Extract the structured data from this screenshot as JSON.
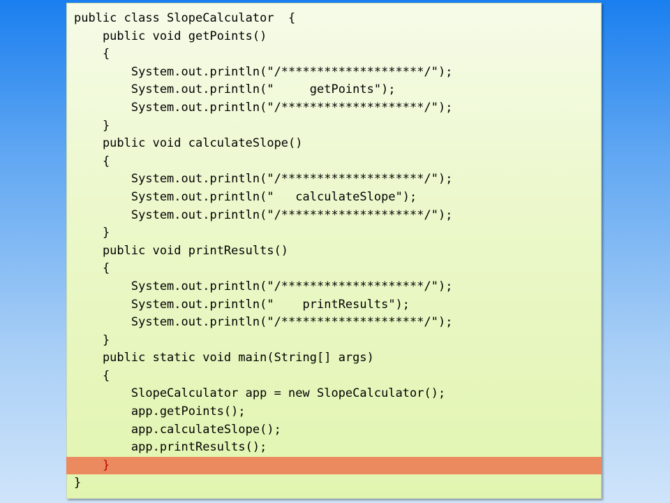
{
  "editor": {
    "highlighted_line_index": 25,
    "colors": {
      "highlight": "#ec8a5f",
      "highlight_text": "#c00000",
      "panel": "#ecf8cc"
    },
    "lines": [
      "public class SlopeCalculator  {",
      "    public void getPoints()",
      "    {",
      "        System.out.println(\"/********************/\");",
      "        System.out.println(\"     getPoints\");",
      "        System.out.println(\"/********************/\");",
      "    }",
      "    public void calculateSlope()",
      "    {",
      "        System.out.println(\"/********************/\");",
      "        System.out.println(\"   calculateSlope\");",
      "        System.out.println(\"/********************/\");",
      "    }",
      "    public void printResults()",
      "    {",
      "        System.out.println(\"/********************/\");",
      "        System.out.println(\"    printResults\");",
      "        System.out.println(\"/********************/\");",
      "    }",
      "    public static void main(String[] args)",
      "    {",
      "        SlopeCalculator app = new SlopeCalculator();",
      "        app.getPoints();",
      "        app.calculateSlope();",
      "        app.printResults();",
      "    }",
      "}"
    ]
  }
}
